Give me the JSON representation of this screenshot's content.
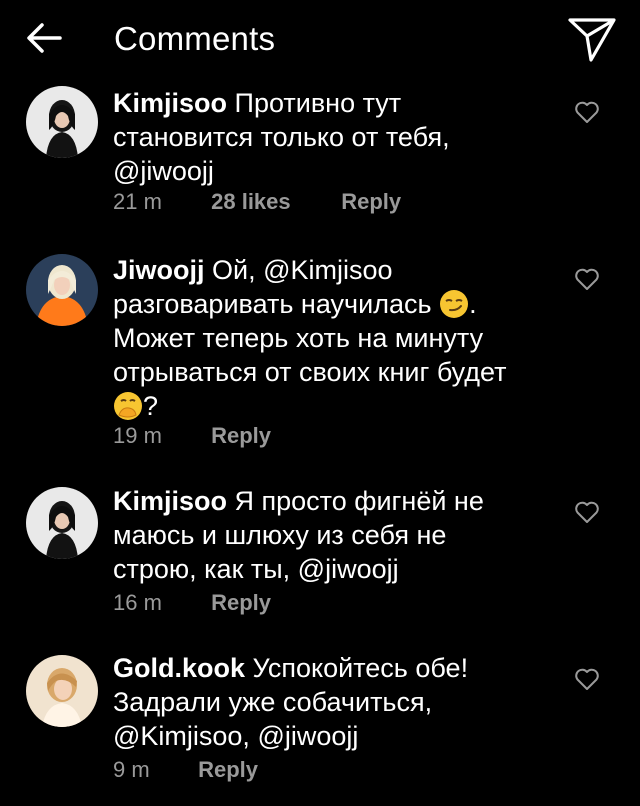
{
  "header": {
    "title": "Comments",
    "back_icon": "arrow-left-icon",
    "send_icon": "paper-plane-icon"
  },
  "comments": [
    {
      "username": "Kimjisoo",
      "text_lines": [
        "Противно тут",
        "становится только от тебя,",
        "@jiwoojj"
      ],
      "time": "21 m",
      "likes": "28 likes",
      "reply": "Reply",
      "avatar": "avatar-dark-hair"
    },
    {
      "username": "Jiwoojj",
      "text_lines": [
        "Ой, @Kimjisoo",
        "разговаривать научилась",
        ". ",
        "Может теперь хоть на минуту",
        "отрываться от своих книг будет",
        "?"
      ],
      "time": "19 m",
      "reply": "Reply",
      "avatar": "avatar-blonde-orange",
      "emojis": [
        "smirking-face-emoji",
        "face-with-hand-over-mouth-emoji"
      ]
    },
    {
      "username": "Kimjisoo",
      "text_lines": [
        "Я просто фигнёй не",
        "маюсь и шлюху из себя не",
        "строю, как ты, @jiwoojj"
      ],
      "time": "16 m",
      "reply": "Reply",
      "avatar": "avatar-dark-hair"
    },
    {
      "username": "Gold.kook",
      "text_lines": [
        "Успокойтесь обе!",
        "Задрали уже собачиться,",
        "@Kimjisoo, @jiwoojj"
      ],
      "time": "9 m",
      "reply": "Reply",
      "avatar": "avatar-light-hair"
    }
  ],
  "colors": {
    "background": "#000000",
    "text": "#ffffff",
    "meta": "#9a9a9a"
  }
}
